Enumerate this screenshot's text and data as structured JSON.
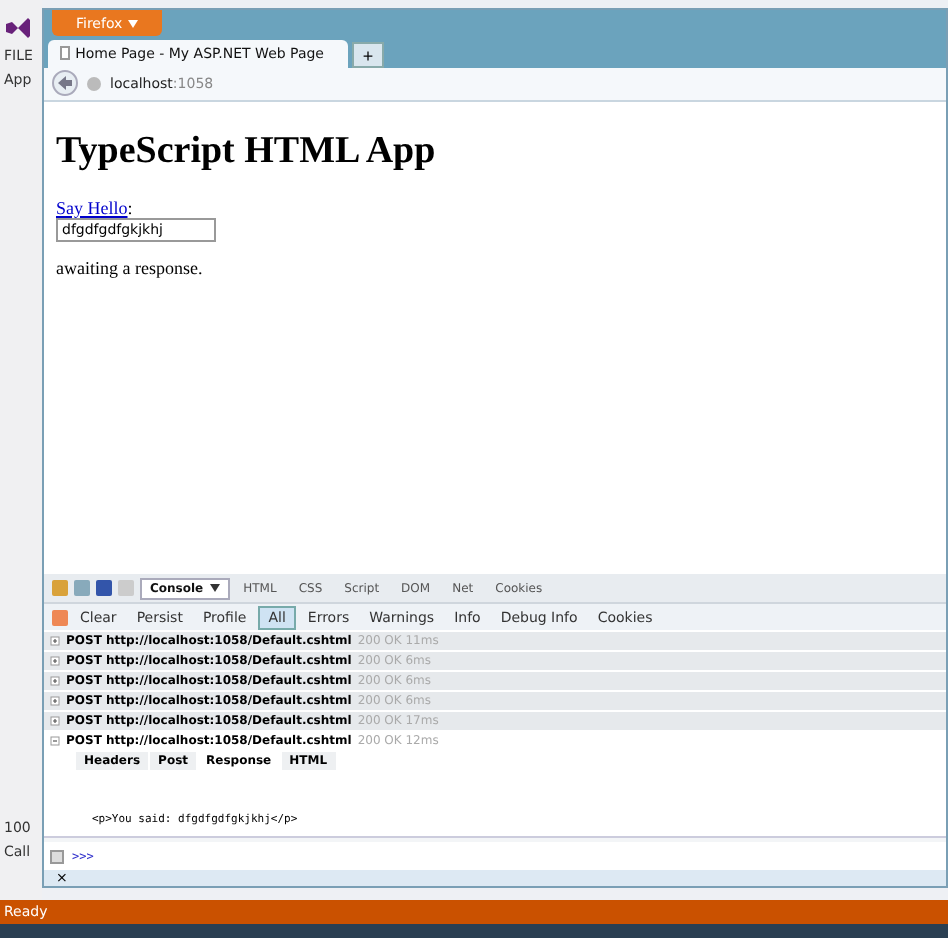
{
  "ide": {
    "menu_label": "FILE",
    "panel_label": "App",
    "zoom": "100",
    "bottom_label": "Call",
    "status": "Ready"
  },
  "browser": {
    "app_button": "Firefox",
    "tabs": [
      {
        "label": "Home Page - My ASP.NET Web Page",
        "selected": true
      }
    ],
    "new_tab": "+",
    "url_host": "localhost",
    "url_port": ":1058"
  },
  "page": {
    "heading": "TypeScript HTML App",
    "link": "Say Hello",
    "link_suffix": ":",
    "input_value": "dfgdfgdfgkjkhj",
    "message": "awaiting a response."
  },
  "firebug": {
    "panel_tabs": [
      {
        "label": "Console",
        "selected": true
      },
      {
        "label": "HTML",
        "selected": false
      },
      {
        "label": "CSS",
        "selected": false
      },
      {
        "label": "Script",
        "selected": false
      },
      {
        "label": "DOM",
        "selected": false
      },
      {
        "label": "Net",
        "selected": false
      },
      {
        "label": "Cookies",
        "selected": false
      }
    ],
    "filters": [
      {
        "label": "Clear",
        "selected": false
      },
      {
        "label": "Persist",
        "selected": false
      },
      {
        "label": "Profile",
        "selected": false
      },
      {
        "label": "All",
        "selected": true
      },
      {
        "label": "Errors",
        "selected": false
      },
      {
        "label": "Warnings",
        "selected": false
      },
      {
        "label": "Info",
        "selected": false
      },
      {
        "label": "Debug Info",
        "selected": false
      },
      {
        "label": "Cookies",
        "selected": false
      }
    ],
    "requests": [
      {
        "text": "POST http://localhost:1058/Default.cshtml",
        "status": "200 OK 11ms",
        "expanded": false
      },
      {
        "text": "POST http://localhost:1058/Default.cshtml",
        "status": "200 OK 6ms",
        "expanded": false
      },
      {
        "text": "POST http://localhost:1058/Default.cshtml",
        "status": "200 OK 6ms",
        "expanded": false
      },
      {
        "text": "POST http://localhost:1058/Default.cshtml",
        "status": "200 OK 6ms",
        "expanded": false
      },
      {
        "text": "POST http://localhost:1058/Default.cshtml",
        "status": "200 OK 17ms",
        "expanded": false
      },
      {
        "text": "POST http://localhost:1058/Default.cshtml",
        "status": "200 OK 12ms",
        "expanded": true
      }
    ],
    "detail_tabs": [
      {
        "label": "Headers",
        "selected": false
      },
      {
        "label": "Post",
        "selected": false
      },
      {
        "label": "Response",
        "selected": true
      },
      {
        "label": "HTML",
        "selected": false
      }
    ],
    "response": "<p>You said: dfgdfgdfgkjkhj</p>",
    "prompt": ">>>",
    "close": "×"
  }
}
